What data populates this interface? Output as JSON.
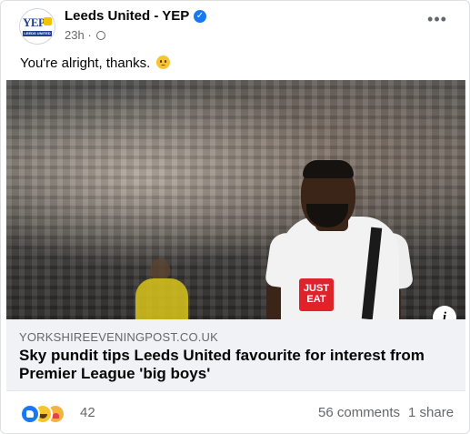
{
  "post": {
    "page_name": "Leeds United - YEP",
    "verified_icon": "verified-badge-icon",
    "time": "23h",
    "separator": "·",
    "privacy_icon": "globe-icon",
    "more_icon": "more-options-icon",
    "more_label": "•••",
    "avatar_text": "YEP",
    "avatar_subtext": "LEEDS UNITED",
    "caption": "You're alright, thanks.",
    "caption_emoji": "worried-face-emoji"
  },
  "link_preview": {
    "domain": "YORKSHIREEVENINGPOST.CO.UK",
    "title": "Sky pundit tips Leeds United favourite for interest from Premier League 'big boys'",
    "info_label": "i",
    "image_sponsor_text": "JUST EAT"
  },
  "engagement": {
    "reaction_icons": [
      "like-icon",
      "haha-icon",
      "care-icon"
    ],
    "reaction_count": "42",
    "comments": "56 comments",
    "shares": "1 share"
  },
  "colors": {
    "brand_blue": "#1877f2",
    "secondary_text": "#65676b",
    "link_bg": "#f0f2f5",
    "sponsor_red": "#e0232b"
  }
}
